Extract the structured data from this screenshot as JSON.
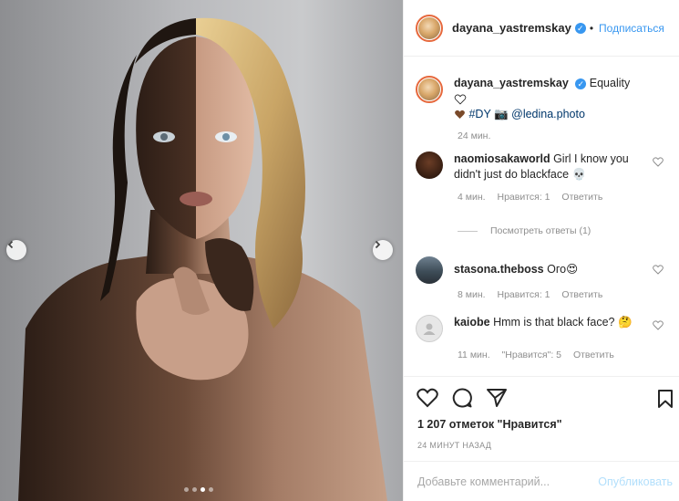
{
  "header": {
    "username": "dayana_yastremskay",
    "separator": "•",
    "follow_label": "Подписаться"
  },
  "caption": {
    "username": "dayana_yastremskay",
    "text_line1": "Equality",
    "text_line2": "#DY",
    "mention": "@ledina.photo",
    "time": "24 мин."
  },
  "comments": [
    {
      "username": "naomiosakaworld",
      "text": "Girl I know you didn't just do blackface 💀",
      "time": "4 мин.",
      "likes": "Нравится: 1",
      "reply": "Ответить"
    },
    {
      "username": "stasona.theboss",
      "text": "Ого😍",
      "time": "8 мин.",
      "likes": "Нравится: 1",
      "reply": "Ответить"
    },
    {
      "username": "kaiobe",
      "text": "Hmm is that black face? 🤔",
      "time": "11 мин.",
      "likes": "\"Нравится\": 5",
      "reply": "Ответить"
    }
  ],
  "view_replies": "Посмотреть ответы (1)",
  "likes_count": "1 207 отметок \"Нравится\"",
  "post_time": "24 МИНУТ НАЗАД",
  "add_comment": {
    "placeholder": "Добавьте комментарий...",
    "post_label": "Опубликовать"
  },
  "carousel": {
    "slide_count": 4,
    "active_slide": 3
  },
  "colors": {
    "link_blue": "#3897f0",
    "verified_blue": "#3897f0",
    "muted_text": "#8e8e8e",
    "post_button_disabled": "#b2dffc"
  }
}
